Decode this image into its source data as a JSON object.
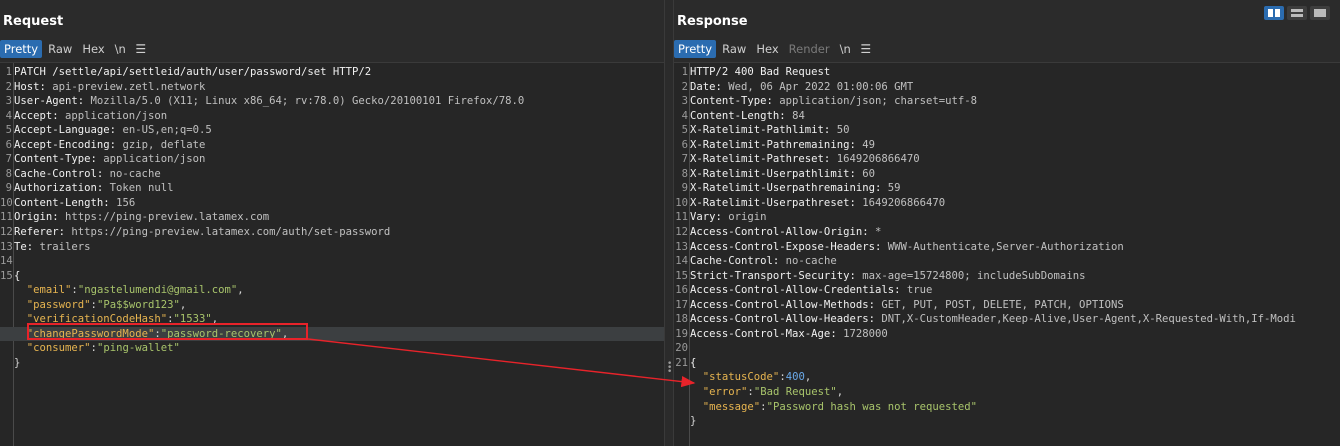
{
  "request": {
    "title": "Request",
    "tabs": [
      "Pretty",
      "Raw",
      "Hex",
      "\\n"
    ],
    "lines": [
      {
        "n": "1",
        "k": "PATCH /settle/api/settleid/auth/user/password/set HTTP/2",
        "v": ""
      },
      {
        "n": "2",
        "k": "Host: ",
        "v": "api-preview.zetl.network"
      },
      {
        "n": "3",
        "k": "User-Agent: ",
        "v": "Mozilla/5.0 (X11; Linux x86_64; rv:78.0) Gecko/20100101 Firefox/78.0"
      },
      {
        "n": "4",
        "k": "Accept: ",
        "v": "application/json"
      },
      {
        "n": "5",
        "k": "Accept-Language: ",
        "v": "en-US,en;q=0.5"
      },
      {
        "n": "6",
        "k": "Accept-Encoding: ",
        "v": "gzip, deflate"
      },
      {
        "n": "7",
        "k": "Content-Type: ",
        "v": "application/json"
      },
      {
        "n": "8",
        "k": "Cache-Control: ",
        "v": "no-cache"
      },
      {
        "n": "9",
        "k": "Authorization: ",
        "v": "Token null"
      },
      {
        "n": "10",
        "k": "Content-Length: ",
        "v": "156"
      },
      {
        "n": "11",
        "k": "Origin: ",
        "v": "https://ping-preview.latamex.com"
      },
      {
        "n": "12",
        "k": "Referer: ",
        "v": "https://ping-preview.latamex.com/auth/set-password"
      },
      {
        "n": "13",
        "k": "Te: ",
        "v": "trailers"
      },
      {
        "n": "14",
        "k": "",
        "v": ""
      },
      {
        "n": "15",
        "k": "{",
        "v": ""
      }
    ],
    "json": [
      {
        "key": "\"email\"",
        "val": "\"ngastelumendi@gmail.com\"",
        "end": ","
      },
      {
        "key": "\"password\"",
        "val": "\"Pa$$word123\"",
        "end": ","
      },
      {
        "key": "\"verificationCodeHash\"",
        "val": "\"1533\"",
        "end": ","
      },
      {
        "key": "\"changePasswordMode\"",
        "val": "\"password-recovery\"",
        "end": ","
      },
      {
        "key": "\"consumer\"",
        "val": "\"ping-wallet\"",
        "end": ""
      }
    ],
    "close": "}"
  },
  "response": {
    "title": "Response",
    "tabs": [
      "Pretty",
      "Raw",
      "Hex",
      "Render",
      "\\n"
    ],
    "lines": [
      {
        "n": "1",
        "k": "HTTP/2 400 Bad Request",
        "v": ""
      },
      {
        "n": "2",
        "k": "Date: ",
        "v": "Wed, 06 Apr 2022 01:00:06 GMT"
      },
      {
        "n": "3",
        "k": "Content-Type: ",
        "v": "application/json; charset=utf-8"
      },
      {
        "n": "4",
        "k": "Content-Length: ",
        "v": "84"
      },
      {
        "n": "5",
        "k": "X-Ratelimit-Pathlimit: ",
        "v": "50"
      },
      {
        "n": "6",
        "k": "X-Ratelimit-Pathremaining: ",
        "v": "49"
      },
      {
        "n": "7",
        "k": "X-Ratelimit-Pathreset: ",
        "v": "1649206866470"
      },
      {
        "n": "8",
        "k": "X-Ratelimit-Userpathlimit: ",
        "v": "60"
      },
      {
        "n": "9",
        "k": "X-Ratelimit-Userpathremaining: ",
        "v": "59"
      },
      {
        "n": "10",
        "k": "X-Ratelimit-Userpathreset: ",
        "v": "1649206866470"
      },
      {
        "n": "11",
        "k": "Vary: ",
        "v": "origin"
      },
      {
        "n": "12",
        "k": "Access-Control-Allow-Origin: ",
        "v": "*"
      },
      {
        "n": "13",
        "k": "Access-Control-Expose-Headers: ",
        "v": "WWW-Authenticate,Server-Authorization"
      },
      {
        "n": "14",
        "k": "Cache-Control: ",
        "v": "no-cache"
      },
      {
        "n": "15",
        "k": "Strict-Transport-Security: ",
        "v": "max-age=15724800; includeSubDomains"
      },
      {
        "n": "16",
        "k": "Access-Control-Allow-Credentials: ",
        "v": "true"
      },
      {
        "n": "17",
        "k": "Access-Control-Allow-Methods: ",
        "v": "GET, PUT, POST, DELETE, PATCH, OPTIONS"
      },
      {
        "n": "18",
        "k": "Access-Control-Allow-Headers: ",
        "v": "DNT,X-CustomHeader,Keep-Alive,User-Agent,X-Requested-With,If-Modi"
      },
      {
        "n": "19",
        "k": "Access-Control-Max-Age: ",
        "v": "1728000"
      },
      {
        "n": "20",
        "k": "",
        "v": ""
      },
      {
        "n": "21",
        "k": "{",
        "v": ""
      }
    ],
    "json": [
      {
        "key": "\"statusCode\"",
        "val": "400",
        "end": ",",
        "num": true
      },
      {
        "key": "\"error\"",
        "val": "\"Bad Request\"",
        "end": ","
      },
      {
        "key": "\"message\"",
        "val": "\"Password hash was not requested\"",
        "end": ""
      }
    ],
    "close": "}"
  },
  "colors": {
    "accent": "#2b6cb0",
    "annotation": "#e8232a",
    "json_key": "#e6b450",
    "json_string": "#a8c46b",
    "json_number": "#6aa9e9"
  }
}
